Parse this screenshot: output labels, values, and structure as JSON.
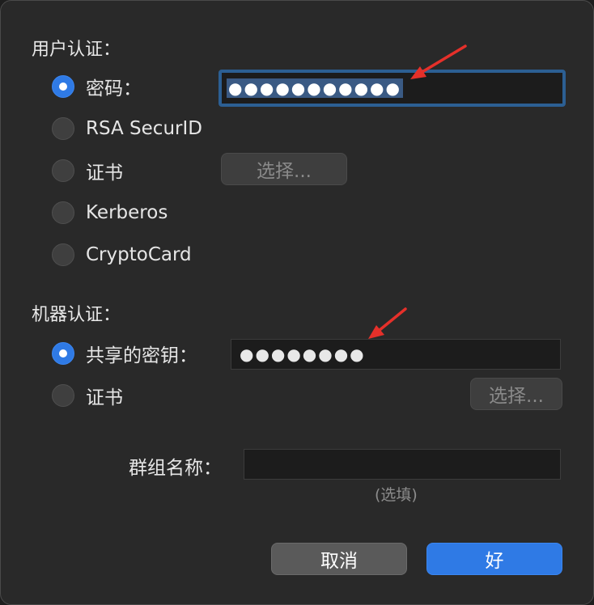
{
  "user_auth": {
    "title": "用户认证：",
    "options": [
      {
        "label": "密码：",
        "checked": true
      },
      {
        "label": "RSA SecurID",
        "checked": false
      },
      {
        "label": "证书",
        "checked": false
      },
      {
        "label": "Kerberos",
        "checked": false
      },
      {
        "label": "CryptoCard",
        "checked": false
      }
    ],
    "password_value": "●●●●●●●●●●●",
    "cert_select_label": "选择..."
  },
  "machine_auth": {
    "title": "机器认证：",
    "options": [
      {
        "label": "共享的密钥：",
        "checked": true
      },
      {
        "label": "证书",
        "checked": false
      }
    ],
    "shared_key_value": "●●●●●●●●",
    "cert_select_label": "选择..."
  },
  "group": {
    "label": "群组名称：",
    "value": "",
    "hint": "(选填)"
  },
  "footer": {
    "cancel_label": "取消",
    "ok_label": "好"
  },
  "colors": {
    "accent": "#2f7ae5",
    "annotation_arrow": "#e5302a",
    "dialog_bg": "#292929"
  }
}
